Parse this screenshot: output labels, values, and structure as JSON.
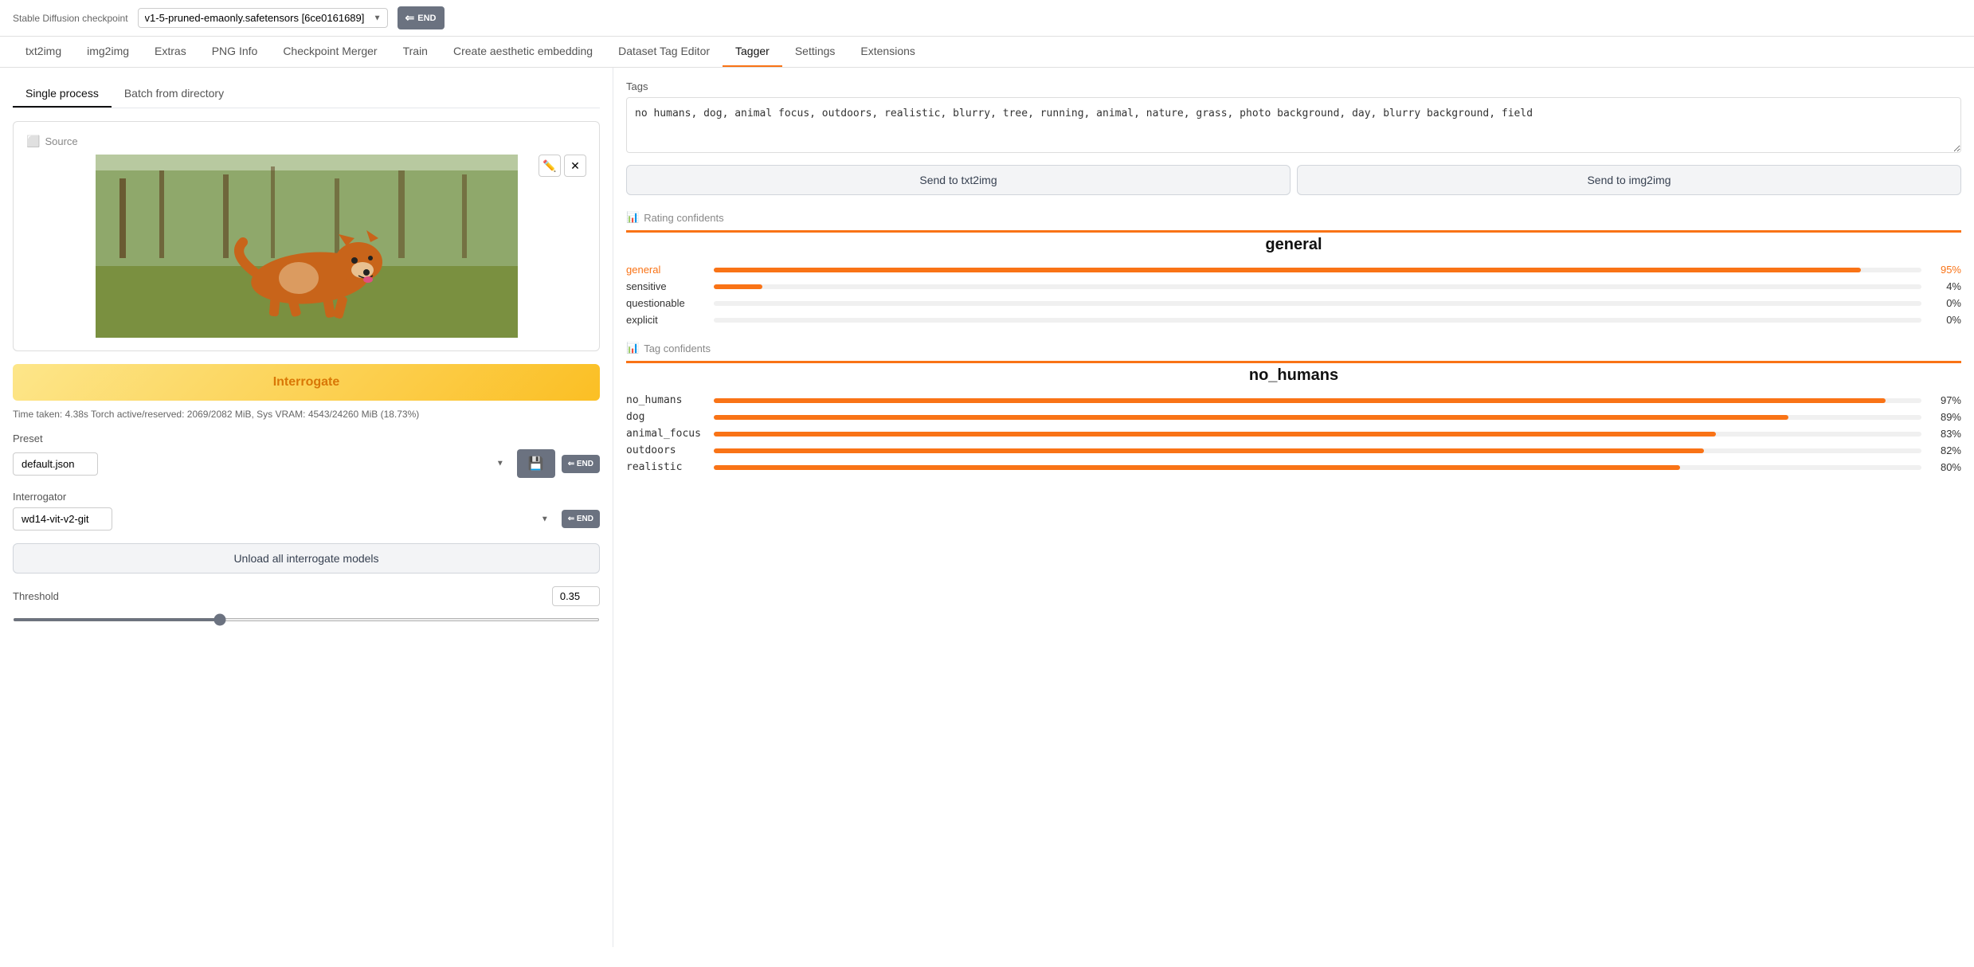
{
  "topBar": {
    "label": "Stable Diffusion checkpoint",
    "checkpointValue": "v1-5-pruned-emaonly.safetensors [6ce0161689]",
    "endBtnLabel": "END"
  },
  "navTabs": [
    {
      "id": "txt2img",
      "label": "txt2img",
      "active": false
    },
    {
      "id": "img2img",
      "label": "img2img",
      "active": false
    },
    {
      "id": "extras",
      "label": "Extras",
      "active": false
    },
    {
      "id": "pnginfo",
      "label": "PNG Info",
      "active": false
    },
    {
      "id": "checkpointmerger",
      "label": "Checkpoint Merger",
      "active": false
    },
    {
      "id": "train",
      "label": "Train",
      "active": false
    },
    {
      "id": "aestheticembedding",
      "label": "Create aesthetic embedding",
      "active": false
    },
    {
      "id": "datasettageditor",
      "label": "Dataset Tag Editor",
      "active": false
    },
    {
      "id": "tagger",
      "label": "Tagger",
      "active": true
    },
    {
      "id": "settings",
      "label": "Settings",
      "active": false
    },
    {
      "id": "extensions",
      "label": "Extensions",
      "active": false
    }
  ],
  "leftPanel": {
    "tabs": [
      {
        "label": "Single process",
        "active": true
      },
      {
        "label": "Batch from directory",
        "active": false
      }
    ],
    "sourceLabel": "Source",
    "editIcon": "✏",
    "closeIcon": "✕",
    "interrogateLabel": "Interrogate",
    "timeInfo": "Time taken: 4.38s Torch active/reserved: 2069/2082 MiB, Sys VRAM: 4543/24260 MiB (18.73%)",
    "presetLabel": "Preset",
    "presetValue": "default.json",
    "presetOptions": [
      "default.json"
    ],
    "saveBtnIcon": "💾",
    "interrogatorLabel": "Interrogator",
    "interrogatorValue": "wd14-vit-v2-git",
    "interrogatorOptions": [
      "wd14-vit-v2-git"
    ],
    "unloadBtnLabel": "Unload all interrogate models",
    "thresholdLabel": "Threshold",
    "thresholdValue": "0.35",
    "thresholdMin": 0,
    "thresholdMax": 1,
    "thresholdStep": 0.01
  },
  "rightPanel": {
    "tagsLabel": "Tags",
    "tagsValue": "no humans, dog, animal focus, outdoors, realistic, blurry, tree, running, animal, nature, grass, photo background, day, blurry background, field",
    "sendToTxt2imgLabel": "Send to txt2img",
    "sendToImg2imgLabel": "Send to img2img",
    "ratingConfidentsLabel": "Rating confidents",
    "ratingChartTitle": "general",
    "ratingBars": [
      {
        "label": "general",
        "pct": 95,
        "display": "95%",
        "highlight": true
      },
      {
        "label": "sensitive",
        "pct": 4,
        "display": "4%",
        "highlight": false
      },
      {
        "label": "questionable",
        "pct": 0,
        "display": "0%",
        "highlight": false
      },
      {
        "label": "explicit",
        "pct": 0,
        "display": "0%",
        "highlight": false
      }
    ],
    "tagConfidentsLabel": "Tag confidents",
    "tagChartTitle": "no_humans",
    "tagBars": [
      {
        "label": "no_humans",
        "pct": 97,
        "display": "97%"
      },
      {
        "label": "dog",
        "pct": 89,
        "display": "89%"
      },
      {
        "label": "animal_focus",
        "pct": 83,
        "display": "83%"
      },
      {
        "label": "outdoors",
        "pct": 82,
        "display": "82%"
      },
      {
        "label": "realistic",
        "pct": 80,
        "display": "80%"
      }
    ]
  }
}
